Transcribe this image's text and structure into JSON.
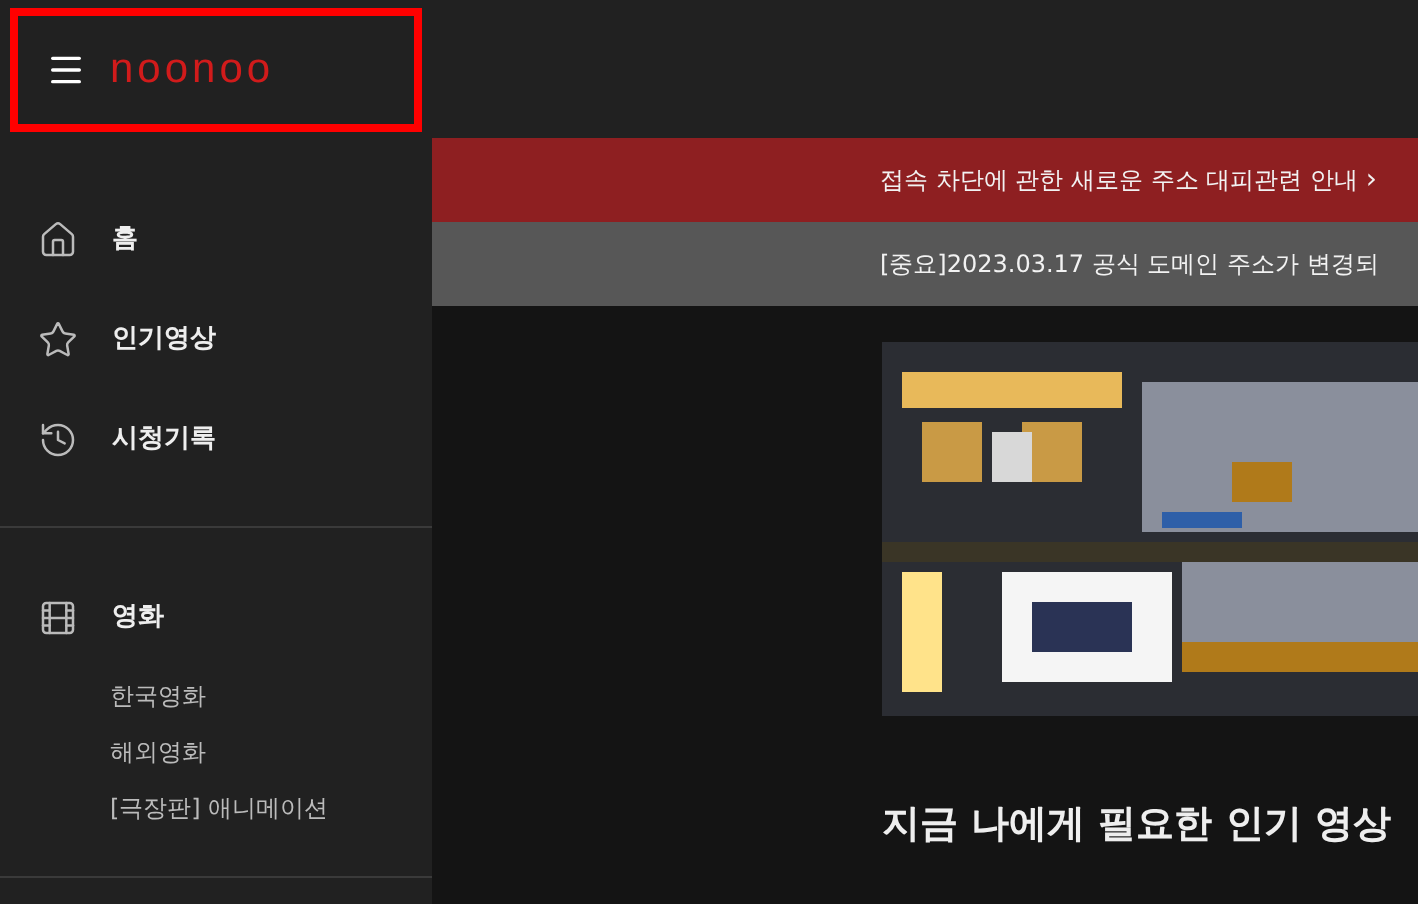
{
  "header": {
    "logo": "noonoo",
    "highlighted": true
  },
  "sidebar": {
    "groups": [
      {
        "items": [
          {
            "kind": "home",
            "label": "홈"
          },
          {
            "kind": "popular",
            "label": "인기영상"
          },
          {
            "kind": "history",
            "label": "시청기록"
          }
        ]
      },
      {
        "items": [
          {
            "kind": "category",
            "label": "영화",
            "children": [
              {
                "label": "한국영화"
              },
              {
                "label": "해외영화"
              },
              {
                "label": "[극장판] 애니메이션"
              }
            ]
          }
        ]
      }
    ]
  },
  "notices": [
    {
      "kind": "alert",
      "text": "접속 차단에 관한 새로운 주소 대피관련 안내",
      "arrow": "›"
    },
    {
      "kind": "info",
      "text": "[중요]2023.03.17 공식 도메인 주소가 변경되"
    }
  ],
  "section": {
    "title": "지금 나에게 필요한 인기 영상"
  }
}
